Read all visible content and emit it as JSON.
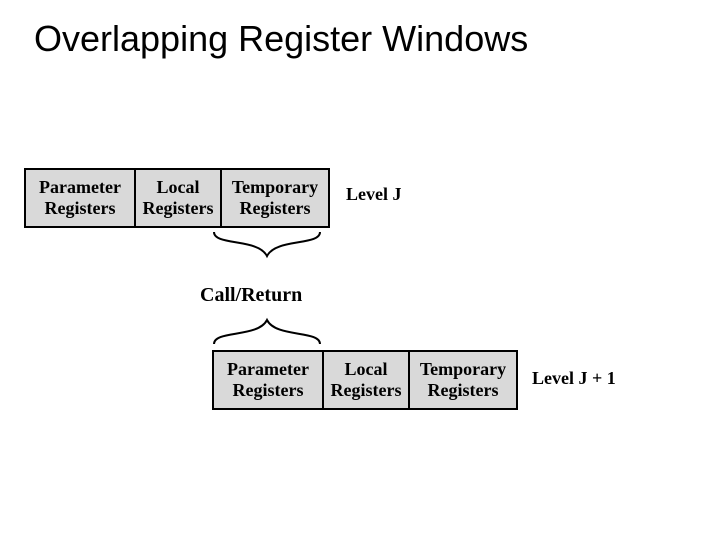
{
  "title": "Overlapping Register Windows",
  "windows": {
    "levelJ": {
      "param": {
        "l1": "Parameter",
        "l2": "Registers"
      },
      "local": {
        "l1": "Local",
        "l2": "Registers"
      },
      "temp": {
        "l1": "Temporary",
        "l2": "Registers"
      },
      "label": "Level J"
    },
    "levelJ1": {
      "param": {
        "l1": "Parameter",
        "l2": "Registers"
      },
      "local": {
        "l1": "Local",
        "l2": "Registers"
      },
      "temp": {
        "l1": "Temporary",
        "l2": "Registers"
      },
      "label": "Level J + 1"
    }
  },
  "callReturn": "Call/Return"
}
